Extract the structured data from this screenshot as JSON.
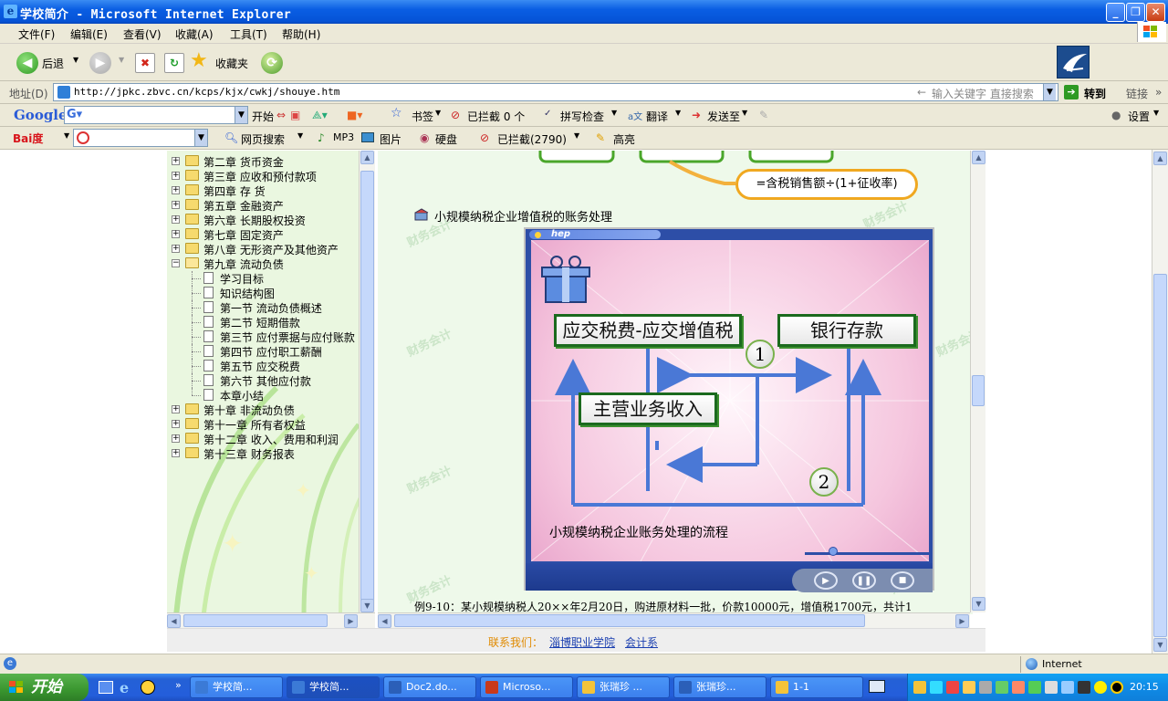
{
  "window": {
    "title": "学校简介 - Microsoft Internet Explorer"
  },
  "menu": [
    "文件(F)",
    "编辑(E)",
    "查看(V)",
    "收藏(A)",
    "工具(T)",
    "帮助(H)"
  ],
  "nav": {
    "back": "后退",
    "favorites": "收藏夹"
  },
  "address": {
    "label": "地址(D)",
    "url": "http://jpkc.zbvc.cn/kcps/kjx/cwkj/shouye.htm",
    "search_hint": "输入关键字 直接搜索",
    "go": "转到",
    "links": "链接"
  },
  "google": {
    "brand": "Google",
    "start": "开始",
    "bookmarks": "书签",
    "blocked": "已拦截 0 个",
    "spell": "拼写检查",
    "translate": "翻译",
    "send": "发送至",
    "settings": "设置"
  },
  "baidu": {
    "brand": "Bai度",
    "web_search": "网页搜索",
    "mp3": "MP3",
    "images": "图片",
    "disk": "硬盘",
    "blocked": "已拦截(2790)",
    "highlight": "高亮"
  },
  "tree": {
    "chapters_before": [
      "第二章 货币资金",
      "第三章 应收和预付款项",
      "第四章 存 货",
      "第五章 金融资产",
      "第六章 长期股权投资",
      "第七章 固定资产",
      "第八章 无形资产及其他资产"
    ],
    "open_chapter": "第九章 流动负债",
    "children": [
      "学习目标",
      "知识结构图",
      "第一节 流动负债概述",
      "第二节 短期借款",
      "第三节 应付票据与应付账款",
      "第四节 应付职工薪酬",
      "第五节 应交税费",
      "第六节 其他应付款",
      "本章小结"
    ],
    "chapters_after": [
      "第十章 非流动负债",
      "第十一章 所有者权益",
      "第十二章 收入、费用和利润",
      "第十三章 财务报表"
    ]
  },
  "main": {
    "formula": "=含税销售额÷(1+征收率)",
    "section_title": "小规模纳税企业增值税的账务处理",
    "watermark": "财务会计",
    "example": "例9-10：某小规模纳税人20××年2月20日，购进原材料一批，价款10000元，增值税1700元，共计1"
  },
  "flash": {
    "hep": "hep",
    "box_tax": "应交税费-应交增值税",
    "box_bank": "银行存款",
    "box_revenue": "主营业务收入",
    "step1": "1",
    "step2": "2",
    "caption": "小规模纳税企业账务处理的流程"
  },
  "footer": {
    "contact": "联系我们：",
    "school": "淄博职业学院",
    "dept": "会计系"
  },
  "status": {
    "zone": "Internet"
  },
  "taskbar": {
    "start": "开始",
    "tasks": [
      "学校简...",
      "学校简...",
      "Doc2.do...",
      "Microso...",
      "张瑞珍 ...",
      "张瑞珍...",
      "1-1"
    ],
    "clock": "20:15"
  },
  "colors": {
    "title_blue": "#0a5ee3",
    "frame_green": "#eaf7e0",
    "box_green": "#1b6a1e",
    "arrow_blue": "#4a78d6"
  }
}
